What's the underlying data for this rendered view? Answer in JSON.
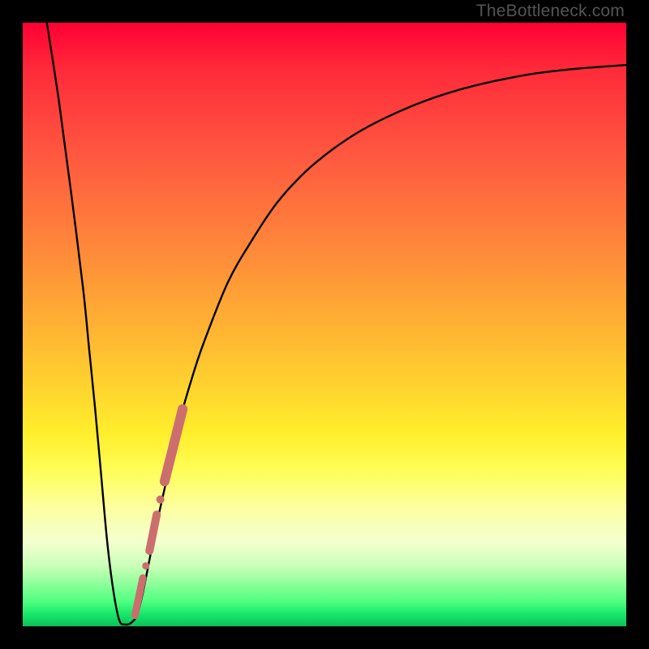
{
  "watermark": "TheBottleneck.com",
  "colors": {
    "frame": "#000000",
    "curve": "#000000",
    "marker_fill": "#cc6e6e",
    "marker_stroke": "#aa4e4e"
  },
  "chart_data": {
    "type": "line",
    "title": "",
    "xlabel": "",
    "ylabel": "",
    "xlim": [
      0,
      100
    ],
    "ylim": [
      0,
      100
    ],
    "grid": false,
    "series": [
      {
        "name": "bottleneck-curve",
        "x": [
          4,
          6,
          8,
          10,
          11,
          12,
          13,
          14,
          15,
          16,
          17,
          18,
          19,
          20,
          22,
          24,
          26,
          28,
          30,
          34,
          38,
          42,
          46,
          50,
          55,
          60,
          66,
          72,
          78,
          85,
          92,
          100
        ],
        "values": [
          100,
          87,
          72,
          56,
          46,
          36,
          25,
          14,
          6,
          1,
          0.3,
          0.6,
          2,
          6,
          16,
          25,
          34,
          41,
          47,
          57,
          64,
          70,
          74.5,
          78,
          81.5,
          84.2,
          86.8,
          88.8,
          90.3,
          91.6,
          92.4,
          93
        ]
      }
    ],
    "markers": [
      {
        "name": "segment-top",
        "x1": 26.5,
        "y1": 36,
        "x2": 23.5,
        "y2": 24,
        "r": 6
      },
      {
        "name": "gap-dot-1",
        "cx": 22.8,
        "cy": 21,
        "r": 5
      },
      {
        "name": "segment-mid",
        "x1": 22.2,
        "y1": 18.5,
        "x2": 21.0,
        "y2": 12.5,
        "r": 5
      },
      {
        "name": "gap-dot-2",
        "cx": 20.4,
        "cy": 10.0,
        "r": 4.5
      },
      {
        "name": "segment-bottom",
        "x1": 19.9,
        "y1": 8.0,
        "x2": 18.6,
        "y2": 1.8,
        "r": 4.5
      }
    ]
  }
}
